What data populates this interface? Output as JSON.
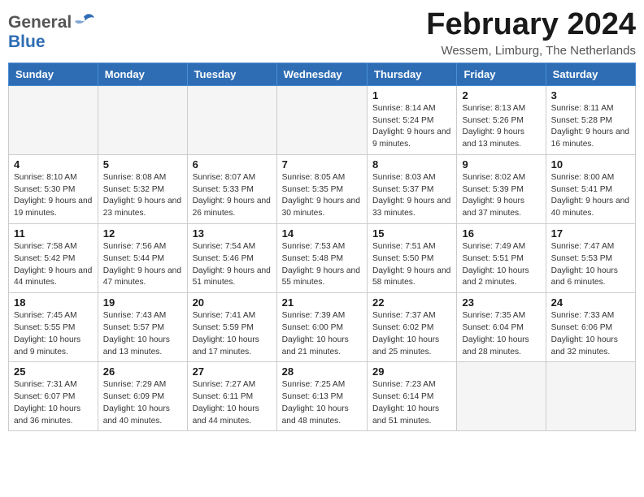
{
  "header": {
    "logo_general": "General",
    "logo_blue": "Blue",
    "month_year": "February 2024",
    "location": "Wessem, Limburg, The Netherlands"
  },
  "days_of_week": [
    "Sunday",
    "Monday",
    "Tuesday",
    "Wednesday",
    "Thursday",
    "Friday",
    "Saturday"
  ],
  "weeks": [
    [
      {
        "day": "",
        "info": ""
      },
      {
        "day": "",
        "info": ""
      },
      {
        "day": "",
        "info": ""
      },
      {
        "day": "",
        "info": ""
      },
      {
        "day": "1",
        "info": "Sunrise: 8:14 AM\nSunset: 5:24 PM\nDaylight: 9 hours\nand 9 minutes."
      },
      {
        "day": "2",
        "info": "Sunrise: 8:13 AM\nSunset: 5:26 PM\nDaylight: 9 hours\nand 13 minutes."
      },
      {
        "day": "3",
        "info": "Sunrise: 8:11 AM\nSunset: 5:28 PM\nDaylight: 9 hours\nand 16 minutes."
      }
    ],
    [
      {
        "day": "4",
        "info": "Sunrise: 8:10 AM\nSunset: 5:30 PM\nDaylight: 9 hours\nand 19 minutes."
      },
      {
        "day": "5",
        "info": "Sunrise: 8:08 AM\nSunset: 5:32 PM\nDaylight: 9 hours\nand 23 minutes."
      },
      {
        "day": "6",
        "info": "Sunrise: 8:07 AM\nSunset: 5:33 PM\nDaylight: 9 hours\nand 26 minutes."
      },
      {
        "day": "7",
        "info": "Sunrise: 8:05 AM\nSunset: 5:35 PM\nDaylight: 9 hours\nand 30 minutes."
      },
      {
        "day": "8",
        "info": "Sunrise: 8:03 AM\nSunset: 5:37 PM\nDaylight: 9 hours\nand 33 minutes."
      },
      {
        "day": "9",
        "info": "Sunrise: 8:02 AM\nSunset: 5:39 PM\nDaylight: 9 hours\nand 37 minutes."
      },
      {
        "day": "10",
        "info": "Sunrise: 8:00 AM\nSunset: 5:41 PM\nDaylight: 9 hours\nand 40 minutes."
      }
    ],
    [
      {
        "day": "11",
        "info": "Sunrise: 7:58 AM\nSunset: 5:42 PM\nDaylight: 9 hours\nand 44 minutes."
      },
      {
        "day": "12",
        "info": "Sunrise: 7:56 AM\nSunset: 5:44 PM\nDaylight: 9 hours\nand 47 minutes."
      },
      {
        "day": "13",
        "info": "Sunrise: 7:54 AM\nSunset: 5:46 PM\nDaylight: 9 hours\nand 51 minutes."
      },
      {
        "day": "14",
        "info": "Sunrise: 7:53 AM\nSunset: 5:48 PM\nDaylight: 9 hours\nand 55 minutes."
      },
      {
        "day": "15",
        "info": "Sunrise: 7:51 AM\nSunset: 5:50 PM\nDaylight: 9 hours\nand 58 minutes."
      },
      {
        "day": "16",
        "info": "Sunrise: 7:49 AM\nSunset: 5:51 PM\nDaylight: 10 hours\nand 2 minutes."
      },
      {
        "day": "17",
        "info": "Sunrise: 7:47 AM\nSunset: 5:53 PM\nDaylight: 10 hours\nand 6 minutes."
      }
    ],
    [
      {
        "day": "18",
        "info": "Sunrise: 7:45 AM\nSunset: 5:55 PM\nDaylight: 10 hours\nand 9 minutes."
      },
      {
        "day": "19",
        "info": "Sunrise: 7:43 AM\nSunset: 5:57 PM\nDaylight: 10 hours\nand 13 minutes."
      },
      {
        "day": "20",
        "info": "Sunrise: 7:41 AM\nSunset: 5:59 PM\nDaylight: 10 hours\nand 17 minutes."
      },
      {
        "day": "21",
        "info": "Sunrise: 7:39 AM\nSunset: 6:00 PM\nDaylight: 10 hours\nand 21 minutes."
      },
      {
        "day": "22",
        "info": "Sunrise: 7:37 AM\nSunset: 6:02 PM\nDaylight: 10 hours\nand 25 minutes."
      },
      {
        "day": "23",
        "info": "Sunrise: 7:35 AM\nSunset: 6:04 PM\nDaylight: 10 hours\nand 28 minutes."
      },
      {
        "day": "24",
        "info": "Sunrise: 7:33 AM\nSunset: 6:06 PM\nDaylight: 10 hours\nand 32 minutes."
      }
    ],
    [
      {
        "day": "25",
        "info": "Sunrise: 7:31 AM\nSunset: 6:07 PM\nDaylight: 10 hours\nand 36 minutes."
      },
      {
        "day": "26",
        "info": "Sunrise: 7:29 AM\nSunset: 6:09 PM\nDaylight: 10 hours\nand 40 minutes."
      },
      {
        "day": "27",
        "info": "Sunrise: 7:27 AM\nSunset: 6:11 PM\nDaylight: 10 hours\nand 44 minutes."
      },
      {
        "day": "28",
        "info": "Sunrise: 7:25 AM\nSunset: 6:13 PM\nDaylight: 10 hours\nand 48 minutes."
      },
      {
        "day": "29",
        "info": "Sunrise: 7:23 AM\nSunset: 6:14 PM\nDaylight: 10 hours\nand 51 minutes."
      },
      {
        "day": "",
        "info": ""
      },
      {
        "day": "",
        "info": ""
      }
    ]
  ]
}
